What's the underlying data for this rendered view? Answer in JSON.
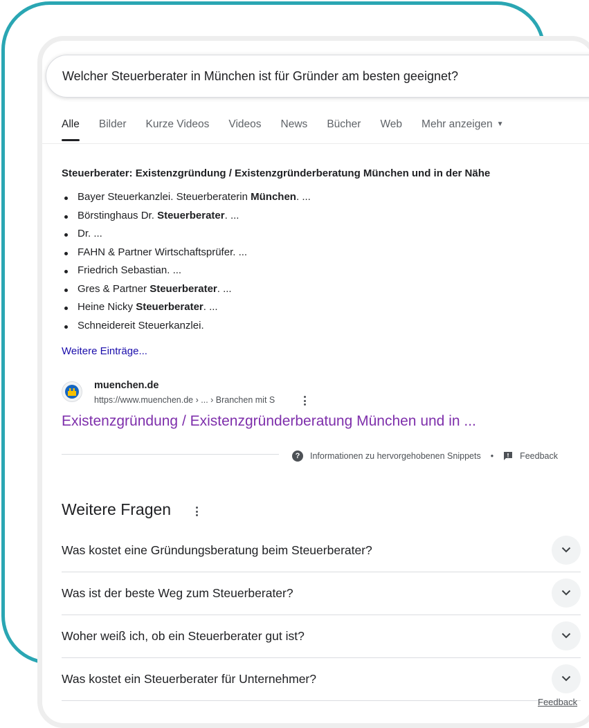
{
  "search": {
    "query": "Welcher Steuerberater in München ist für Gründer am besten geeignet?"
  },
  "tabs": [
    "Alle",
    "Bilder",
    "Kurze Videos",
    "Videos",
    "News",
    "Bücher",
    "Web",
    "Mehr anzeigen"
  ],
  "snippet": {
    "heading": "Steuerberater: Existenzgründung / Existenzgründerberatung München und in der Nähe",
    "items": [
      {
        "text": "Bayer Steuerkanzlei. Steuerberaterin ",
        "bold": "München",
        "after": ". ..."
      },
      {
        "text": "Börstinghaus Dr. ",
        "bold": "Steuerberater",
        "after": ". ..."
      },
      {
        "text": "Dr. ...",
        "bold": "",
        "after": ""
      },
      {
        "text": "FAHN & Partner Wirtschaftsprüfer. ...",
        "bold": "",
        "after": ""
      },
      {
        "text": "Friedrich Sebastian. ...",
        "bold": "",
        "after": ""
      },
      {
        "text": "Gres & Partner ",
        "bold": "Steuerberater",
        "after": ". ..."
      },
      {
        "text": "Heine Nicky ",
        "bold": "Steuerberater",
        "after": ". ..."
      },
      {
        "text": "Schneidereit Steuerkanzlei.",
        "bold": "",
        "after": ""
      }
    ],
    "more_link": "Weitere Einträge..."
  },
  "source": {
    "name": "muenchen.de",
    "url": "https://www.muenchen.de › ... › Branchen mit S",
    "title": "Existenzgründung / Existenzgründerberatung München und in ..."
  },
  "snippet_info": {
    "info_label": "Informationen zu hervorgehobenen Snippets",
    "separator": "•",
    "feedback_label": "Feedback"
  },
  "paa": {
    "title": "Weitere Fragen",
    "questions": [
      "Was kostet eine Gründungsberatung beim Steuerberater?",
      "Was ist der beste Weg zum Steuerberater?",
      "Woher weiß ich, ob ein Steuerberater gut ist?",
      "Was kostet ein Steuerberater für Unternehmer?"
    ],
    "feedback_label": "Feedback"
  },
  "colors": {
    "frame": "#2aa6b3",
    "link": "#1a0dab",
    "visited_title": "#7e2fab"
  },
  "icons": [
    "question-circle-icon",
    "feedback-flag-icon",
    "more-vert-icon",
    "chevron-down-icon",
    "site-favicon-icon",
    "dropdown-caret-icon"
  ]
}
